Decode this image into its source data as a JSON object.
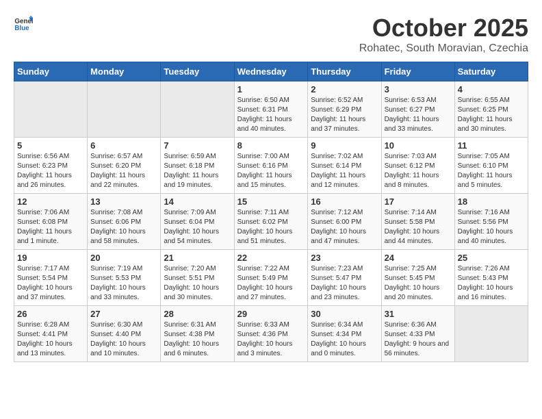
{
  "header": {
    "logo_general": "General",
    "logo_blue": "Blue",
    "title": "October 2025",
    "subtitle": "Rohatec, South Moravian, Czechia"
  },
  "weekdays": [
    "Sunday",
    "Monday",
    "Tuesday",
    "Wednesday",
    "Thursday",
    "Friday",
    "Saturday"
  ],
  "weeks": [
    [
      {
        "day": "",
        "sunrise": "",
        "sunset": "",
        "daylight": ""
      },
      {
        "day": "",
        "sunrise": "",
        "sunset": "",
        "daylight": ""
      },
      {
        "day": "",
        "sunrise": "",
        "sunset": "",
        "daylight": ""
      },
      {
        "day": "1",
        "sunrise": "Sunrise: 6:50 AM",
        "sunset": "Sunset: 6:31 PM",
        "daylight": "Daylight: 11 hours and 40 minutes."
      },
      {
        "day": "2",
        "sunrise": "Sunrise: 6:52 AM",
        "sunset": "Sunset: 6:29 PM",
        "daylight": "Daylight: 11 hours and 37 minutes."
      },
      {
        "day": "3",
        "sunrise": "Sunrise: 6:53 AM",
        "sunset": "Sunset: 6:27 PM",
        "daylight": "Daylight: 11 hours and 33 minutes."
      },
      {
        "day": "4",
        "sunrise": "Sunrise: 6:55 AM",
        "sunset": "Sunset: 6:25 PM",
        "daylight": "Daylight: 11 hours and 30 minutes."
      }
    ],
    [
      {
        "day": "5",
        "sunrise": "Sunrise: 6:56 AM",
        "sunset": "Sunset: 6:23 PM",
        "daylight": "Daylight: 11 hours and 26 minutes."
      },
      {
        "day": "6",
        "sunrise": "Sunrise: 6:57 AM",
        "sunset": "Sunset: 6:20 PM",
        "daylight": "Daylight: 11 hours and 22 minutes."
      },
      {
        "day": "7",
        "sunrise": "Sunrise: 6:59 AM",
        "sunset": "Sunset: 6:18 PM",
        "daylight": "Daylight: 11 hours and 19 minutes."
      },
      {
        "day": "8",
        "sunrise": "Sunrise: 7:00 AM",
        "sunset": "Sunset: 6:16 PM",
        "daylight": "Daylight: 11 hours and 15 minutes."
      },
      {
        "day": "9",
        "sunrise": "Sunrise: 7:02 AM",
        "sunset": "Sunset: 6:14 PM",
        "daylight": "Daylight: 11 hours and 12 minutes."
      },
      {
        "day": "10",
        "sunrise": "Sunrise: 7:03 AM",
        "sunset": "Sunset: 6:12 PM",
        "daylight": "Daylight: 11 hours and 8 minutes."
      },
      {
        "day": "11",
        "sunrise": "Sunrise: 7:05 AM",
        "sunset": "Sunset: 6:10 PM",
        "daylight": "Daylight: 11 hours and 5 minutes."
      }
    ],
    [
      {
        "day": "12",
        "sunrise": "Sunrise: 7:06 AM",
        "sunset": "Sunset: 6:08 PM",
        "daylight": "Daylight: 11 hours and 1 minute."
      },
      {
        "day": "13",
        "sunrise": "Sunrise: 7:08 AM",
        "sunset": "Sunset: 6:06 PM",
        "daylight": "Daylight: 10 hours and 58 minutes."
      },
      {
        "day": "14",
        "sunrise": "Sunrise: 7:09 AM",
        "sunset": "Sunset: 6:04 PM",
        "daylight": "Daylight: 10 hours and 54 minutes."
      },
      {
        "day": "15",
        "sunrise": "Sunrise: 7:11 AM",
        "sunset": "Sunset: 6:02 PM",
        "daylight": "Daylight: 10 hours and 51 minutes."
      },
      {
        "day": "16",
        "sunrise": "Sunrise: 7:12 AM",
        "sunset": "Sunset: 6:00 PM",
        "daylight": "Daylight: 10 hours and 47 minutes."
      },
      {
        "day": "17",
        "sunrise": "Sunrise: 7:14 AM",
        "sunset": "Sunset: 5:58 PM",
        "daylight": "Daylight: 10 hours and 44 minutes."
      },
      {
        "day": "18",
        "sunrise": "Sunrise: 7:16 AM",
        "sunset": "Sunset: 5:56 PM",
        "daylight": "Daylight: 10 hours and 40 minutes."
      }
    ],
    [
      {
        "day": "19",
        "sunrise": "Sunrise: 7:17 AM",
        "sunset": "Sunset: 5:54 PM",
        "daylight": "Daylight: 10 hours and 37 minutes."
      },
      {
        "day": "20",
        "sunrise": "Sunrise: 7:19 AM",
        "sunset": "Sunset: 5:53 PM",
        "daylight": "Daylight: 10 hours and 33 minutes."
      },
      {
        "day": "21",
        "sunrise": "Sunrise: 7:20 AM",
        "sunset": "Sunset: 5:51 PM",
        "daylight": "Daylight: 10 hours and 30 minutes."
      },
      {
        "day": "22",
        "sunrise": "Sunrise: 7:22 AM",
        "sunset": "Sunset: 5:49 PM",
        "daylight": "Daylight: 10 hours and 27 minutes."
      },
      {
        "day": "23",
        "sunrise": "Sunrise: 7:23 AM",
        "sunset": "Sunset: 5:47 PM",
        "daylight": "Daylight: 10 hours and 23 minutes."
      },
      {
        "day": "24",
        "sunrise": "Sunrise: 7:25 AM",
        "sunset": "Sunset: 5:45 PM",
        "daylight": "Daylight: 10 hours and 20 minutes."
      },
      {
        "day": "25",
        "sunrise": "Sunrise: 7:26 AM",
        "sunset": "Sunset: 5:43 PM",
        "daylight": "Daylight: 10 hours and 16 minutes."
      }
    ],
    [
      {
        "day": "26",
        "sunrise": "Sunrise: 6:28 AM",
        "sunset": "Sunset: 4:41 PM",
        "daylight": "Daylight: 10 hours and 13 minutes."
      },
      {
        "day": "27",
        "sunrise": "Sunrise: 6:30 AM",
        "sunset": "Sunset: 4:40 PM",
        "daylight": "Daylight: 10 hours and 10 minutes."
      },
      {
        "day": "28",
        "sunrise": "Sunrise: 6:31 AM",
        "sunset": "Sunset: 4:38 PM",
        "daylight": "Daylight: 10 hours and 6 minutes."
      },
      {
        "day": "29",
        "sunrise": "Sunrise: 6:33 AM",
        "sunset": "Sunset: 4:36 PM",
        "daylight": "Daylight: 10 hours and 3 minutes."
      },
      {
        "day": "30",
        "sunrise": "Sunrise: 6:34 AM",
        "sunset": "Sunset: 4:34 PM",
        "daylight": "Daylight: 10 hours and 0 minutes."
      },
      {
        "day": "31",
        "sunrise": "Sunrise: 6:36 AM",
        "sunset": "Sunset: 4:33 PM",
        "daylight": "Daylight: 9 hours and 56 minutes."
      },
      {
        "day": "",
        "sunrise": "",
        "sunset": "",
        "daylight": ""
      }
    ]
  ]
}
